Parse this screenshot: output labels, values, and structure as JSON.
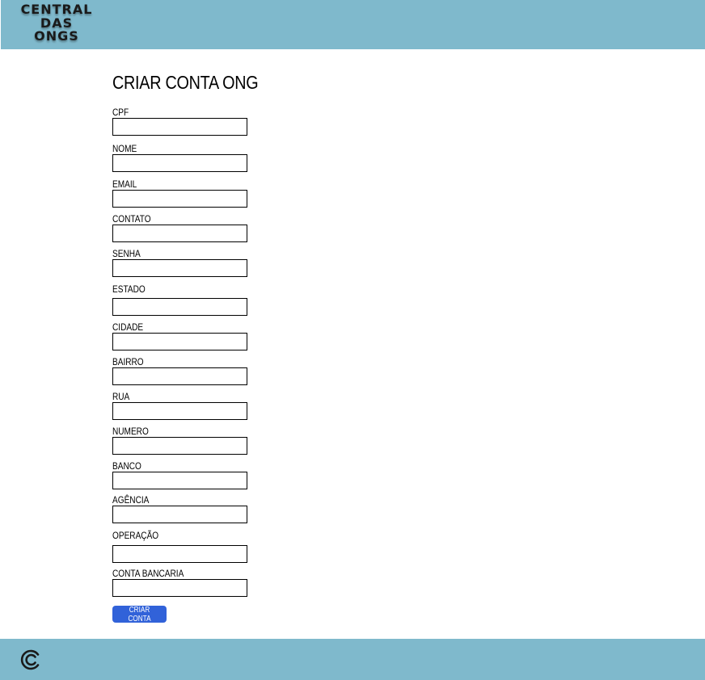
{
  "header": {
    "logo_lines": [
      "CENTRAL",
      "DAS",
      "ONGS"
    ]
  },
  "form": {
    "title": "CRIAR CONTA ONG",
    "fields": [
      {
        "label": "CPF",
        "value": ""
      },
      {
        "label": "NOME",
        "value": ""
      },
      {
        "label": "EMAIL",
        "value": ""
      },
      {
        "label": "CONTATO",
        "value": ""
      },
      {
        "label": "SENHA",
        "value": ""
      },
      {
        "label": "ESTADO",
        "value": ""
      },
      {
        "label": "CIDADE",
        "value": ""
      },
      {
        "label": "BAIRRO",
        "value": ""
      },
      {
        "label": "RUA",
        "value": ""
      },
      {
        "label": "NUMERO",
        "value": ""
      },
      {
        "label": "BANCO",
        "value": ""
      },
      {
        "label": "AGÊNCIA",
        "value": ""
      },
      {
        "label": "OPERAÇÃO",
        "value": ""
      },
      {
        "label": "CONTA BANCARIA",
        "value": ""
      }
    ],
    "submit_label": "CRIAR CONTA"
  },
  "footer": {
    "logo_icon": "central-das-ongs-c-icon"
  },
  "colors": {
    "bar": "#7fb9cc",
    "button": "#3162d9"
  }
}
